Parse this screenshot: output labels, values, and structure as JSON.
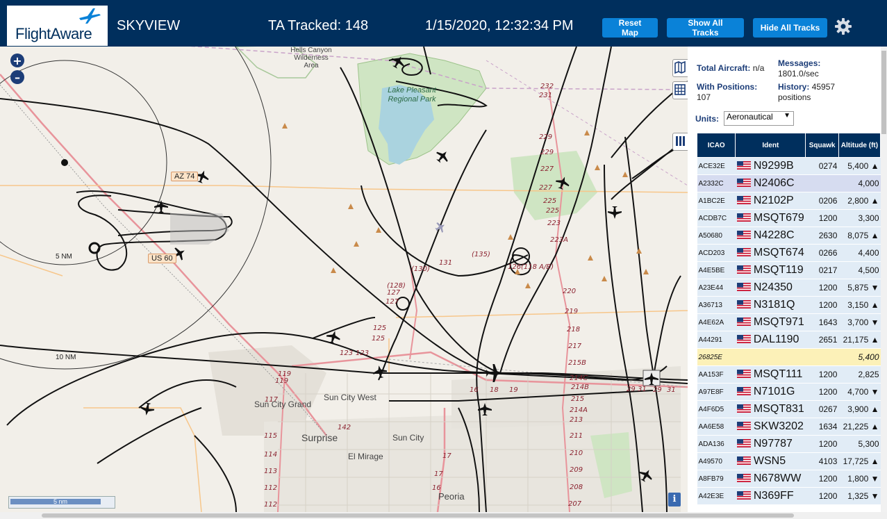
{
  "header": {
    "brand": "FlightAware",
    "title": "SKYVIEW",
    "tracked": "TA Tracked: 148",
    "datetime": "1/15/2020, 12:32:34 PM",
    "buttons": {
      "reset": "Reset Map",
      "show": "Show All Tracks",
      "hide": "Hide All Tracks"
    }
  },
  "map": {
    "zoom_in": "+",
    "zoom_out": "–",
    "scale": "5 nm",
    "info": "i",
    "labels": {
      "wilderness": "Hells Canyon Wilderness Area",
      "park": "Lake Pleasant Regional Park",
      "surprise": "Surprise",
      "sun_city": "Sun City",
      "sun_city_west": "Sun City West",
      "sun_city_grand": "Sun City Grand",
      "el_mirage": "El Mirage",
      "peoria": "Peoria",
      "ring5": "5 NM",
      "ring10": "10 NM",
      "az74": "AZ 74",
      "us60": "US 60"
    }
  },
  "stats": {
    "total_label": "Total Aircraft:",
    "total_value": "n/a",
    "positions_label": "With Positions:",
    "positions_value": "107",
    "messages_label": "Messages:",
    "messages_value": "1801.0/sec",
    "history_label": "History:",
    "history_value": "45957",
    "history_unit": "positions",
    "units_label": "Units:",
    "units_value": "Aeronautical"
  },
  "table": {
    "headers": {
      "icao": "ICAO",
      "ident": "Ident",
      "squawk": "Squawk",
      "alt": "Altitude (ft)"
    },
    "rows": [
      {
        "icao": "ACE32E",
        "ident": "N9299B",
        "squawk": "0274",
        "alt": "5,400 ▲",
        "flag": true
      },
      {
        "icao": "A2332C",
        "ident": "N2406C",
        "squawk": "",
        "alt": "4,000",
        "flag": true
      },
      {
        "icao": "A1BC2E",
        "ident": "N2102P",
        "squawk": "0206",
        "alt": "2,800 ▲",
        "flag": true
      },
      {
        "icao": "ACDB7C",
        "ident": "MSQT679",
        "squawk": "1200",
        "alt": "3,300",
        "flag": true
      },
      {
        "icao": "A50680",
        "ident": "N4228C",
        "squawk": "2630",
        "alt": "8,075 ▲",
        "flag": true
      },
      {
        "icao": "ACD203",
        "ident": "MSQT674",
        "squawk": "0266",
        "alt": "4,400",
        "flag": true
      },
      {
        "icao": "A4E5BE",
        "ident": "MSQT119",
        "squawk": "0217",
        "alt": "4,500",
        "flag": true
      },
      {
        "icao": "A23E44",
        "ident": "N24350",
        "squawk": "1200",
        "alt": "5,875 ▼",
        "flag": true
      },
      {
        "icao": "A36713",
        "ident": "N3181Q",
        "squawk": "1200",
        "alt": "3,150 ▲",
        "flag": true
      },
      {
        "icao": "A4E62A",
        "ident": "MSQT971",
        "squawk": "1643",
        "alt": "3,700 ▼",
        "flag": true
      },
      {
        "icao": "A44291",
        "ident": "DAL1190",
        "squawk": "2651",
        "alt": "21,175 ▲",
        "flag": true
      },
      {
        "icao": "26825E",
        "ident": "",
        "squawk": "",
        "alt": "5,400",
        "flag": false
      },
      {
        "icao": "AA153F",
        "ident": "MSQT111",
        "squawk": "1200",
        "alt": "2,825",
        "flag": true
      },
      {
        "icao": "A97E8F",
        "ident": "N7101G",
        "squawk": "1200",
        "alt": "4,700 ▼",
        "flag": true
      },
      {
        "icao": "A4F6D5",
        "ident": "MSQT831",
        "squawk": "0267",
        "alt": "3,900 ▲",
        "flag": true
      },
      {
        "icao": "AA6E58",
        "ident": "SKW3202",
        "squawk": "1634",
        "alt": "21,225 ▲",
        "flag": true
      },
      {
        "icao": "ADA136",
        "ident": "N97787",
        "squawk": "1200",
        "alt": "5,300",
        "flag": true
      },
      {
        "icao": "A49570",
        "ident": "WSN5",
        "squawk": "4103",
        "alt": "17,725 ▲",
        "flag": true
      },
      {
        "icao": "A8FB79",
        "ident": "N678WW",
        "squawk": "1200",
        "alt": "1,800 ▼",
        "flag": true
      },
      {
        "icao": "A42E3E",
        "ident": "N369FF",
        "squawk": "1200",
        "alt": "1,325 ▼",
        "flag": true
      }
    ]
  },
  "colors": {
    "header_bg": "#002f5d",
    "button": "#0a82d8",
    "row": "#e1ecf6",
    "row_selected": "#d6dcf0",
    "row_mlat": "#fcf1b8"
  }
}
